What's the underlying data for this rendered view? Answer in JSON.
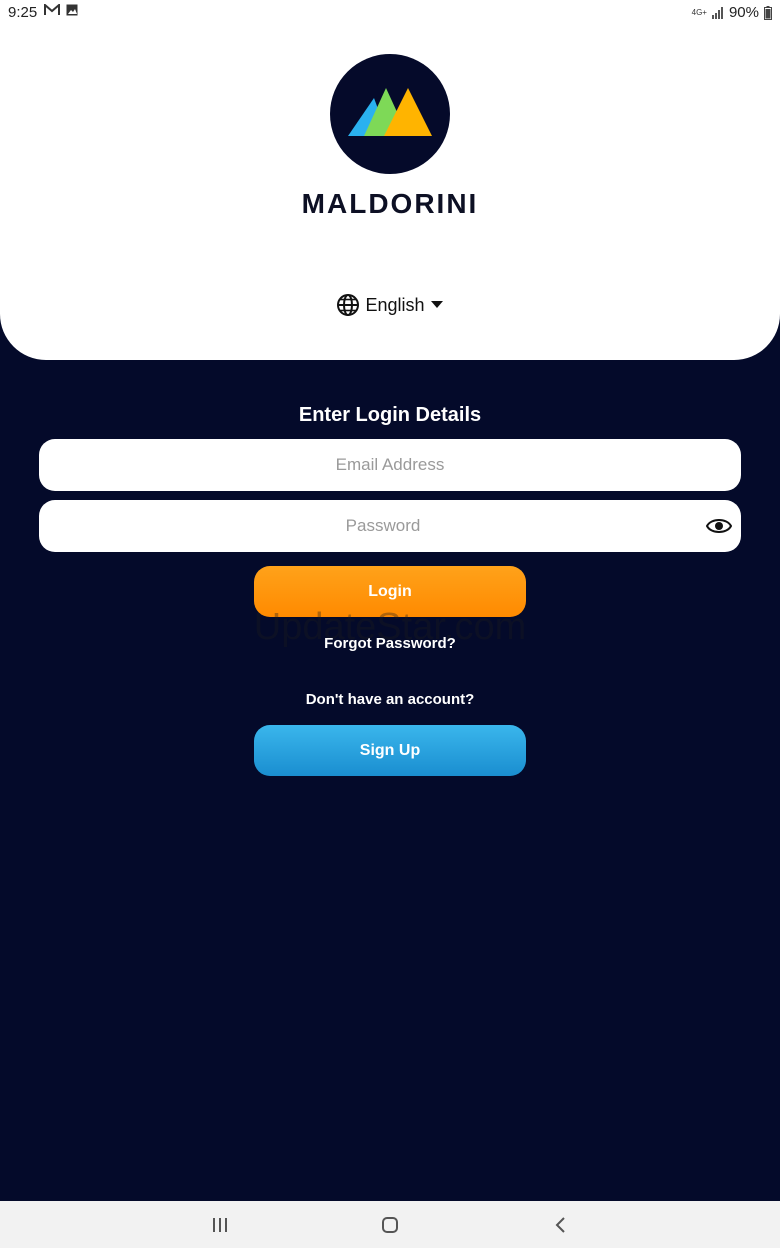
{
  "status_bar": {
    "time": "9:25",
    "left_icons": [
      "gmail-icon",
      "image-icon"
    ],
    "network": "4G+",
    "battery": "90%"
  },
  "brand": {
    "name": "MALDORINI",
    "logo_colors": [
      "#2ab1ef",
      "#7ed957",
      "#ffb400"
    ]
  },
  "language": {
    "selected": "English"
  },
  "login": {
    "heading": "Enter Login Details",
    "email_placeholder": "Email Address",
    "password_placeholder": "Password",
    "login_label": "Login",
    "forgot_label": "Forgot Password?",
    "no_account_text": "Don't have an account?",
    "signup_label": "Sign Up"
  },
  "watermark": "UpdateStar.com",
  "colors": {
    "background": "#040a2a",
    "login_button": "#ff9600",
    "signup_button": "#27a3df"
  }
}
